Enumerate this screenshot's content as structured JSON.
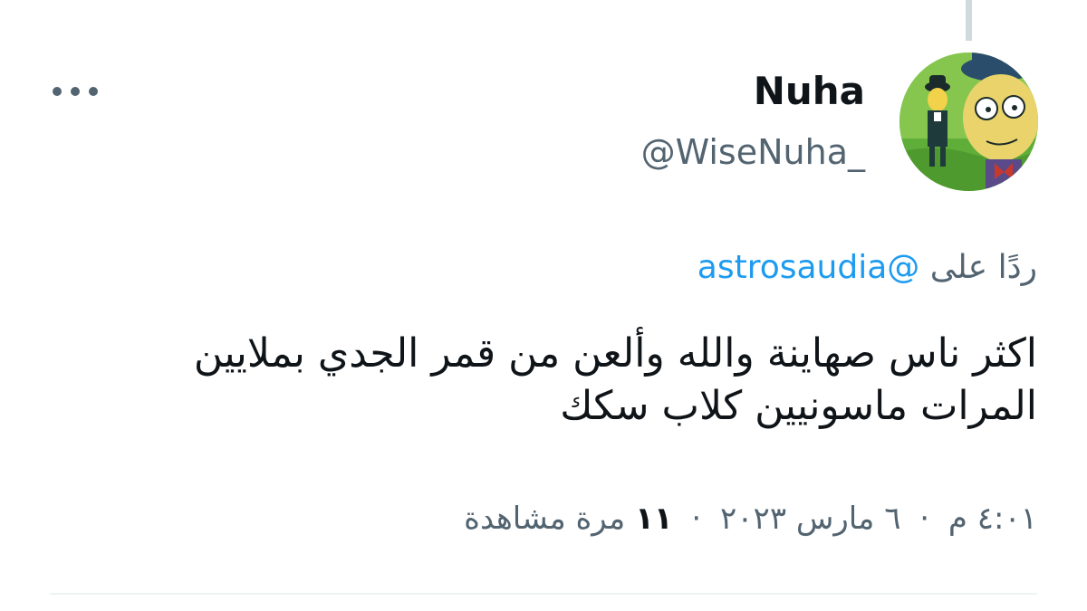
{
  "tweet": {
    "author_name": "Nuha",
    "author_handle": "@WiseNuha_",
    "reply_prefix": "ردًا على",
    "reply_to": "@astrosaudia",
    "text_line1": "اكثر ناس صهاينة والله وألعن من قمر الجدي بملايين",
    "text_line2": "المرات ماسونيين كلاب سكك",
    "time": "٤:٠١ م",
    "date": "٦ مارس ٢٠٢٣",
    "separator": "·",
    "views_count": "١١",
    "views_label": "مرة مشاهدة"
  },
  "icons": {
    "more": "more-options-icon",
    "avatar": "avatar-image"
  },
  "colors": {
    "text": "#0f1419",
    "secondary": "#536471",
    "link": "#1d9bf0",
    "divider": "#eff3f4",
    "thread_line": "#cfd9de"
  }
}
